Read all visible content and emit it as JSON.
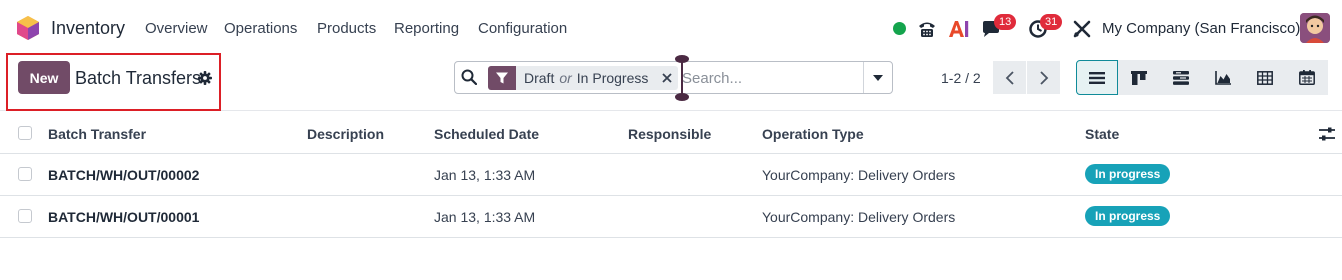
{
  "navbar": {
    "app_name": "Inventory",
    "menu": [
      "Overview",
      "Operations",
      "Products",
      "Reporting",
      "Configuration"
    ],
    "messages_count": "13",
    "activities_count": "31",
    "company": "My Company (San Francisco)"
  },
  "control_panel": {
    "new_label": "New",
    "title": "Batch Transfers",
    "search": {
      "facet_value_1": "Draft",
      "facet_or": "or",
      "facet_value_2": "In Progress",
      "placeholder": "Search..."
    },
    "pager": "1-2 / 2"
  },
  "table": {
    "columns": [
      "Batch Transfer",
      "Description",
      "Scheduled Date",
      "Responsible",
      "Operation Type",
      "State"
    ],
    "rows": [
      {
        "name": "BATCH/WH/OUT/00002",
        "description": "",
        "scheduled": "Jan 13, 1:33 AM",
        "responsible": "",
        "operation_type": "YourCompany: Delivery Orders",
        "state": "In progress"
      },
      {
        "name": "BATCH/WH/OUT/00001",
        "description": "",
        "scheduled": "Jan 13, 1:33 AM",
        "responsible": "",
        "operation_type": "YourCompany: Delivery Orders",
        "state": "In progress"
      }
    ]
  },
  "colors": {
    "brand": "#714b67",
    "state_badge": "#17a2b8",
    "highlight_box": "#dc1f26",
    "notification_badge": "#e02b3b"
  },
  "icons": [
    "app-logo-icon",
    "phone-icon",
    "ai-icon",
    "chat-icon",
    "clock-icon",
    "tools-icon",
    "gear-icon",
    "search-icon",
    "filter-icon",
    "close-icon",
    "caret-down-icon",
    "chevron-left-icon",
    "chevron-right-icon",
    "list-view-icon",
    "kanban-view-icon",
    "activity-view-icon",
    "graph-view-icon",
    "pivot-view-icon",
    "calendar-view-icon",
    "optional-columns-icon"
  ]
}
